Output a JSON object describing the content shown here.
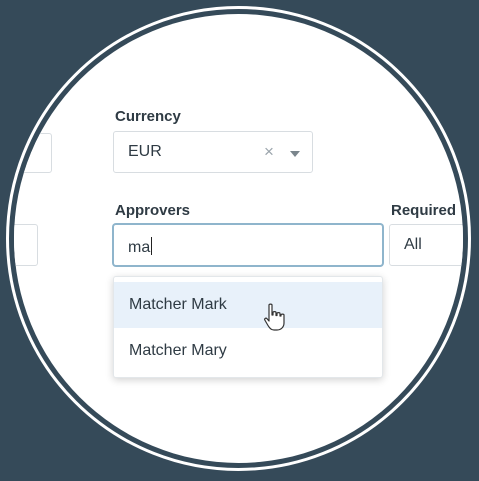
{
  "currency": {
    "label": "Currency",
    "value": "EUR",
    "clear_icon": "clear-x-icon",
    "chevron_icon": "chevron-down-icon"
  },
  "approvers": {
    "label": "Approvers",
    "value": "ma",
    "options": [
      "Matcher Mark",
      "Matcher Mary"
    ],
    "highlighted_option": "Matcher Mark"
  },
  "required": {
    "label": "Required",
    "value": "All"
  },
  "icons": {
    "clear": "×",
    "pointer": "hand-pointer-cursor-icon"
  },
  "colors": {
    "background": "#354a59",
    "focus_border": "#8fb5cc",
    "highlight": "#e8f1fa",
    "text": "#2f3b44"
  }
}
